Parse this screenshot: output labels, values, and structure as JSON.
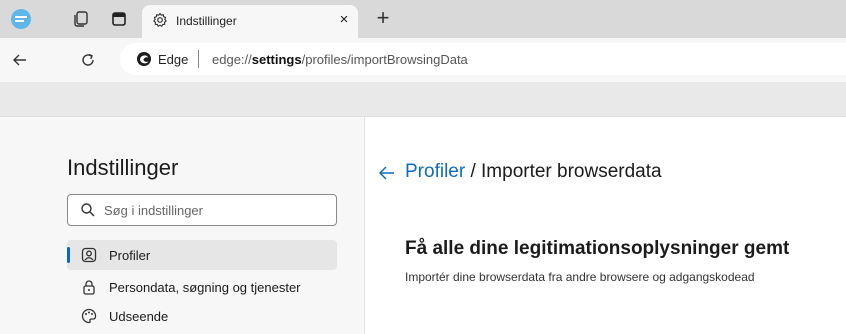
{
  "tab": {
    "title": "Indstillinger",
    "close": "×"
  },
  "new_tab": "+",
  "address": {
    "site": "Edge",
    "url_prefix": "edge://",
    "url_host": "settings",
    "url_path": "/profiles/importBrowsingData"
  },
  "sidebar": {
    "title": "Indstillinger",
    "search_placeholder": "Søg i indstillinger",
    "items": [
      {
        "label": "Profiler",
        "icon": "profile-icon",
        "active": true
      },
      {
        "label": "Persondata, søgning og tjenester",
        "icon": "lock-icon",
        "active": false
      },
      {
        "label": "Udseende",
        "icon": "palette-icon",
        "active": false
      }
    ]
  },
  "main": {
    "breadcrumb_link": "Profiler",
    "breadcrumb_rest": " / Importer browserdata",
    "headline": "Få alle dine legitimationsoplysninger gemt",
    "subline": "Importér dine browserdata fra andre browsere og adgangskodead"
  },
  "colors": {
    "accent": "#0f6cbd",
    "active_indicator": "#0a67c4"
  }
}
